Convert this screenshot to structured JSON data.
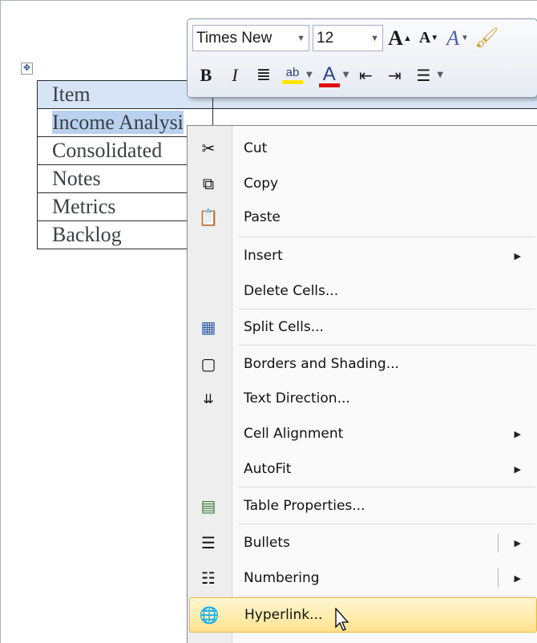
{
  "document": {
    "move_handle_icon": "table-move-handle-icon",
    "table_rows": [
      {
        "cell": "Item",
        "selected": false
      },
      {
        "cell": "Income Analysi",
        "selected": true
      },
      {
        "cell": "Consolidated",
        "selected": false
      },
      {
        "cell": "Notes",
        "selected": false
      },
      {
        "cell": "Metrics",
        "selected": false
      },
      {
        "cell": "Backlog",
        "selected": false
      }
    ]
  },
  "mini_toolbar": {
    "font_name": "Times New",
    "font_size": "12",
    "grow_font": "A",
    "shrink_font": "A",
    "styles": "A",
    "bold": "B",
    "italic": "I",
    "highlight_text": "ab",
    "font_color_letter": "A",
    "colors": {
      "highlight": "#ffe600",
      "font_color": "#e01010"
    }
  },
  "context_menu": {
    "items": [
      {
        "label": "Cut",
        "icon": "scissors-icon"
      },
      {
        "label": "Copy",
        "icon": "copy-icon"
      },
      {
        "label": "Paste",
        "icon": "paste-icon"
      },
      {
        "label": "Insert",
        "icon": "",
        "submenu": true
      },
      {
        "label": "Delete Cells...",
        "icon": ""
      },
      {
        "label": "Split Cells...",
        "icon": "split-cells-icon"
      },
      {
        "label": "Borders and Shading...",
        "icon": "borders-icon"
      },
      {
        "label": "Text Direction...",
        "icon": "text-direction-icon"
      },
      {
        "label": "Cell Alignment",
        "icon": "",
        "submenu": true
      },
      {
        "label": "AutoFit",
        "icon": "",
        "submenu": true
      },
      {
        "label": "Table Properties...",
        "icon": "table-properties-icon"
      },
      {
        "label": "Bullets",
        "icon": "bullets-icon",
        "submenu": true,
        "split": true
      },
      {
        "label": "Numbering",
        "icon": "numbering-icon",
        "submenu": true,
        "split": true
      },
      {
        "label": "Hyperlink...",
        "icon": "hyperlink-icon",
        "highlighted": true
      }
    ],
    "colors": {
      "highlight_top": "#fff6d2",
      "highlight_bottom": "#ffe38e",
      "highlight_border": "#e6b73c"
    }
  }
}
